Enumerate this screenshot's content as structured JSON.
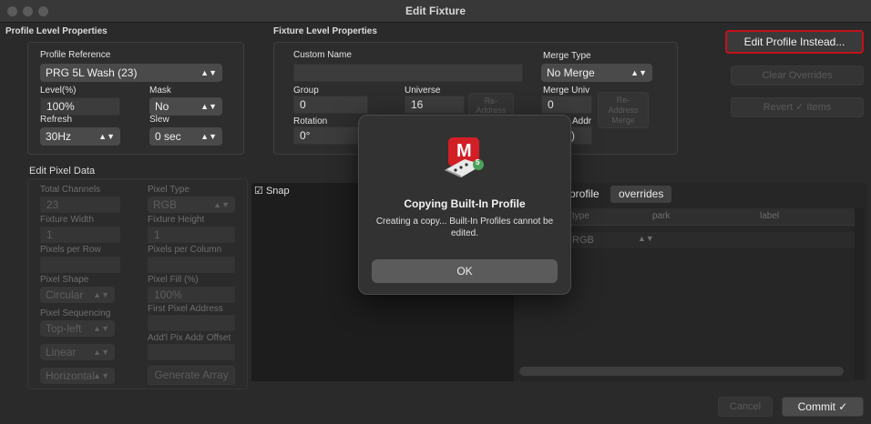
{
  "window": {
    "title": "Edit Fixture"
  },
  "profile_level": {
    "section_title": "Profile Level Properties",
    "profile_reference": {
      "label": "Profile Reference",
      "value": "PRG 5L Wash (23)"
    },
    "level": {
      "label": "Level(%)",
      "value": "100%"
    },
    "mask": {
      "label": "Mask",
      "value": "No"
    },
    "refresh": {
      "label": "Refresh",
      "value": "30Hz"
    },
    "slew": {
      "label": "Slew",
      "value": "0 sec"
    }
  },
  "fixture_level": {
    "section_title": "Fixture Level Properties",
    "custom_name": {
      "label": "Custom Name",
      "value": ""
    },
    "merge_type": {
      "label": "Merge Type",
      "value": "No Merge"
    },
    "group": {
      "label": "Group",
      "value": "0"
    },
    "universe": {
      "label": "Universe",
      "value": "16"
    },
    "readdress_button": "Re-\nAddress",
    "merge_univ": {
      "label": "Merge Univ",
      "value": "0"
    },
    "readdress_merge_button": "Re-\nAddress\nMerge",
    "rotation": {
      "label": "Rotation",
      "value": "0°"
    },
    "merge_addr": {
      "label": "Addr",
      "value": "A)"
    }
  },
  "right_buttons": {
    "edit_profile": "Edit Profile Instead...",
    "clear_overrides": "Clear Overrides",
    "revert_items": "Revert ✓ Items"
  },
  "pixel_data": {
    "section_title": "Edit Pixel Data",
    "total_channels": {
      "label": "Total Channels",
      "value": "23"
    },
    "pixel_type": {
      "label": "Pixel Type",
      "value": "RGB"
    },
    "fixture_width": {
      "label": "Fixture Width",
      "value": "1"
    },
    "fixture_height": {
      "label": "Fixture Height",
      "value": "1"
    },
    "pixels_per_row": {
      "label": "Pixels per Row",
      "value": ""
    },
    "pixels_per_column": {
      "label": "Pixels per Column",
      "value": ""
    },
    "pixel_shape": {
      "label": "Pixel Shape",
      "value": "Circular"
    },
    "pixel_fill": {
      "label": "Pixel Fill (%)",
      "value": "100%"
    },
    "pixel_sequencing": {
      "label": "Pixel Sequencing",
      "value": "Top-left"
    },
    "first_pixel_address": {
      "label": "First Pixel Address",
      "value": ""
    },
    "addl_pix_addr_offset": {
      "label": "Add'l Pix Addr Offset",
      "value": ""
    },
    "sequencing_mode": "Linear",
    "orientation": "Horizontal",
    "generate_array": "Generate Array",
    "snap": {
      "label": "Snap",
      "checked": "☑"
    }
  },
  "table": {
    "tabs": [
      "profile",
      "overrides"
    ],
    "columns": [
      "type",
      "park",
      "label"
    ],
    "rows": [
      {
        "type": "RGB"
      }
    ]
  },
  "footer": {
    "cancel": "Cancel",
    "commit": "Commit ✓"
  },
  "dialog": {
    "app_icon_letter": "M",
    "app_icon_badge": "5",
    "title": "Copying Built-In Profile",
    "message": "Creating a copy... Built-In Profiles cannot be edited.",
    "ok": "OK"
  },
  "colors": {
    "accent_red": "#c3121b",
    "window_bg": "#2a2a2a"
  }
}
